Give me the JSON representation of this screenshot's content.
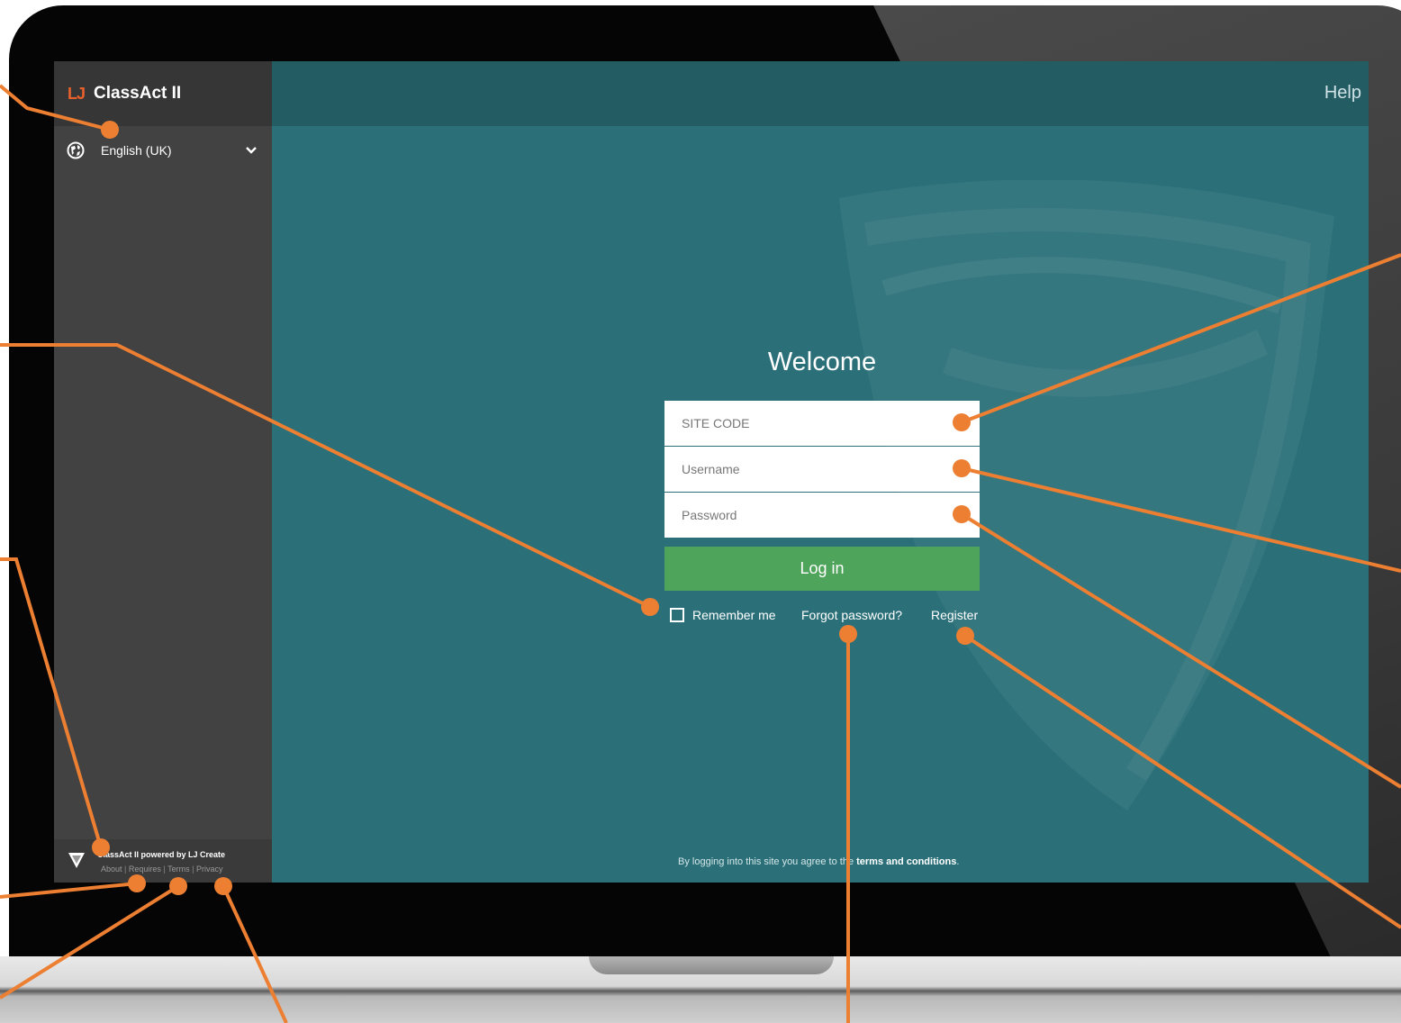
{
  "app": {
    "logo": "LJ",
    "name": "ClassAct II"
  },
  "sidebar": {
    "language": "English (UK)",
    "footer": {
      "powered_by": "ClassAct II powered by LJ Create",
      "links": [
        "About",
        "Requires",
        "Terms",
        "Privacy"
      ],
      "separator": "|"
    }
  },
  "topbar": {
    "help": "Help"
  },
  "login": {
    "title": "Welcome",
    "site_code_placeholder": "SITE CODE",
    "username_placeholder": "Username",
    "password_placeholder": "Password",
    "login_button": "Log in",
    "remember_me": "Remember me",
    "forgot_password": "Forgot password?",
    "register": "Register"
  },
  "terms": {
    "prefix": "By logging into this site you agree to the ",
    "link": "terms and conditions",
    "suffix": "."
  },
  "colors": {
    "accent": "#e8812c",
    "main_bg": "#2b7079",
    "topbar_bg": "#245c63",
    "sidebar_bg": "#424242",
    "login_button": "#4ea45a"
  }
}
